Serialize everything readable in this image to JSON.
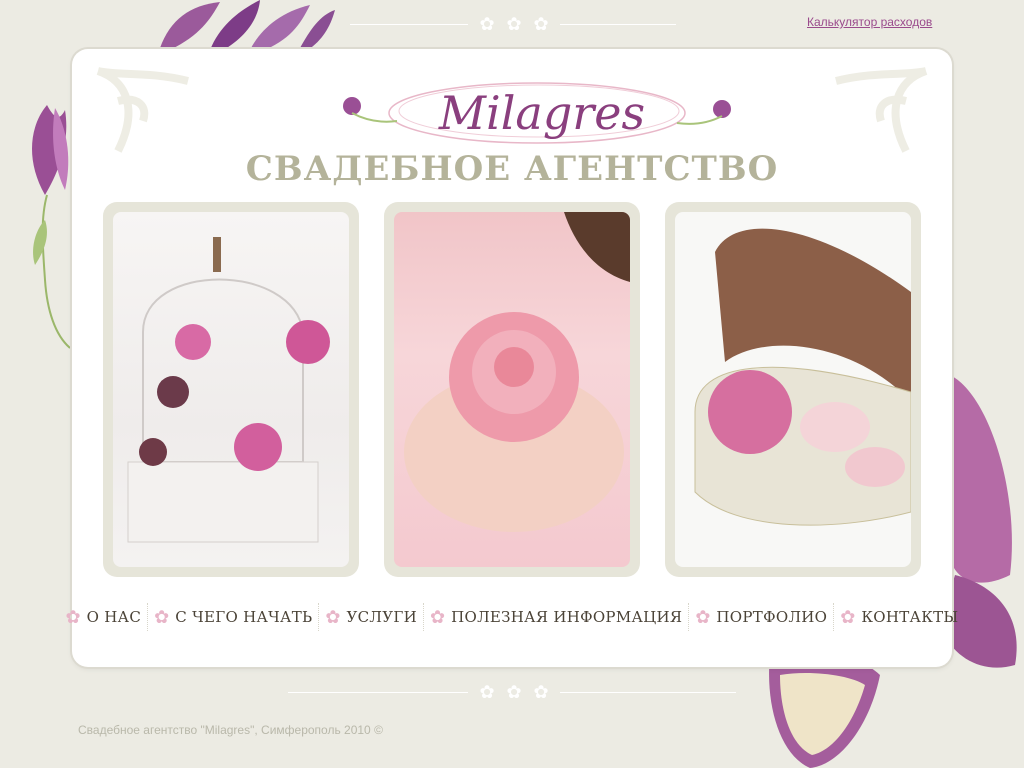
{
  "header": {
    "calculator_link": "Калькулятор расходов"
  },
  "logo": {
    "name": "Milagres",
    "tagline": "Свадебное агентство"
  },
  "photos": [
    {
      "name": "birdcage-roses-photo"
    },
    {
      "name": "rose-in-hands-photo"
    },
    {
      "name": "heart-box-roses-photo"
    }
  ],
  "nav": {
    "items": [
      {
        "label": "О НАС"
      },
      {
        "label": "С ЧЕГО НАЧАТЬ"
      },
      {
        "label": "УСЛУГИ"
      },
      {
        "label": "ПОЛЕЗНАЯ ИНФОРМАЦИЯ"
      },
      {
        "label": "ПОРТФОЛИО"
      },
      {
        "label": "КОНТАКТЫ"
      }
    ],
    "bullet_icon": "flower-icon"
  },
  "footer": {
    "copyright": "Свадебное агентство \"Milagres\", Симферополь 2010 ©"
  },
  "colors": {
    "background": "#ecebe3",
    "accent": "#8a3f7e",
    "link": "#9a4a8c",
    "subtitle": "#b4b39a",
    "nav_text": "#4b4337"
  }
}
